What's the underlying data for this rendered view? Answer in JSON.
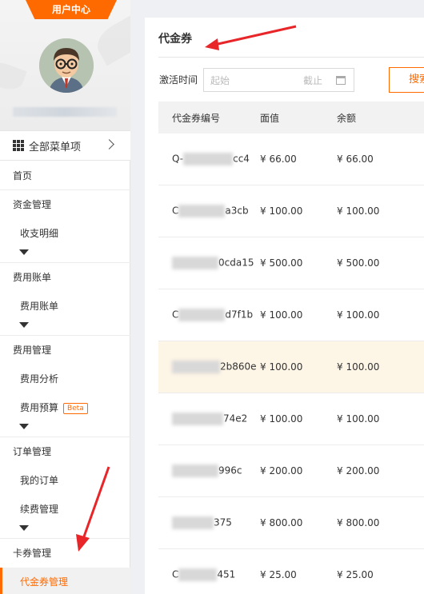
{
  "sidebar": {
    "header_tab": "用户中心",
    "all_menu": "全部菜单项",
    "home": "首页",
    "groups": [
      {
        "title": "资金管理",
        "items": [
          "收支明细"
        ]
      },
      {
        "title": "费用账单",
        "items": [
          "费用账单"
        ]
      },
      {
        "title": "费用管理",
        "items": [
          "费用分析",
          "费用预算"
        ]
      },
      {
        "title": "订单管理",
        "items": [
          "我的订单",
          "续费管理"
        ]
      },
      {
        "title": "卡券管理",
        "items": [
          "代金券管理"
        ]
      }
    ],
    "beta_badge": "Beta"
  },
  "main": {
    "title": "代金券",
    "filter": {
      "label": "激活时间",
      "start_placeholder": "起始",
      "end_placeholder": "截止",
      "search_button": "搜索"
    },
    "table": {
      "headers": [
        "代金券编号",
        "面值",
        "余额"
      ],
      "rows": [
        {
          "id_prefix": "Q-",
          "id_suffix": "cc4",
          "face": "¥ 66.00",
          "balance": "¥ 66.00"
        },
        {
          "id_prefix": "C",
          "id_suffix": "a3cb",
          "face": "¥ 100.00",
          "balance": "¥ 100.00"
        },
        {
          "id_prefix": "",
          "id_suffix": "0cda15",
          "face": "¥ 500.00",
          "balance": "¥ 500.00"
        },
        {
          "id_prefix": "C",
          "id_suffix": "d7f1b",
          "face": "¥ 100.00",
          "balance": "¥ 100.00"
        },
        {
          "id_prefix": "",
          "id_suffix": "2b860e",
          "face": "¥ 100.00",
          "balance": "¥ 100.00",
          "highlight": true
        },
        {
          "id_prefix": "",
          "id_suffix": "74e2",
          "face": "¥ 100.00",
          "balance": "¥ 100.00"
        },
        {
          "id_prefix": "",
          "id_suffix": "996c",
          "face": "¥ 200.00",
          "balance": "¥ 200.00"
        },
        {
          "id_prefix": "",
          "id_suffix": "375",
          "face": "¥ 800.00",
          "balance": "¥ 800.00"
        },
        {
          "id_prefix": "C",
          "id_suffix": "451",
          "face": "¥ 25.00",
          "balance": "¥ 25.00"
        }
      ]
    }
  },
  "colors": {
    "accent": "#ff6a00",
    "annotation_arrow": "#e8262a",
    "row_highlight": "#fdf5e6"
  },
  "icons": [
    "grid-icon",
    "chevron-right-icon",
    "calendar-icon",
    "expand-triangle-icon"
  ]
}
